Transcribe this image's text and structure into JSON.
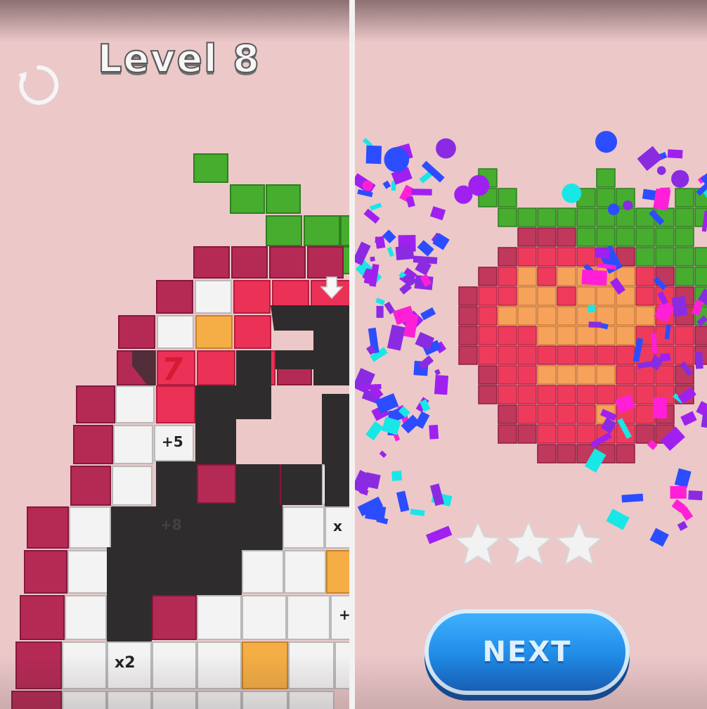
{
  "header": {
    "level_title": "Level 8"
  },
  "board": {
    "count_number": "7",
    "bonus_plus5": "+5",
    "bonus_x2": "x2",
    "bonus_faded": "+8",
    "edge_x": "x",
    "edge_plus": "+"
  },
  "result": {
    "stars_earned": 3,
    "stars_total": 3,
    "next_label": "NEXT"
  },
  "colors": {
    "background": "#ecc8c9",
    "leaf_green": "#46ad2f",
    "berry_red": "#ec3156",
    "berry_maroon": "#b52a55",
    "seed_orange": "#f4ae45",
    "button_blue": "#1f8be6",
    "star_white": "#f2f2f2"
  },
  "icons": [
    "restart-icon",
    "arrow-down-icon",
    "star-icon"
  ]
}
